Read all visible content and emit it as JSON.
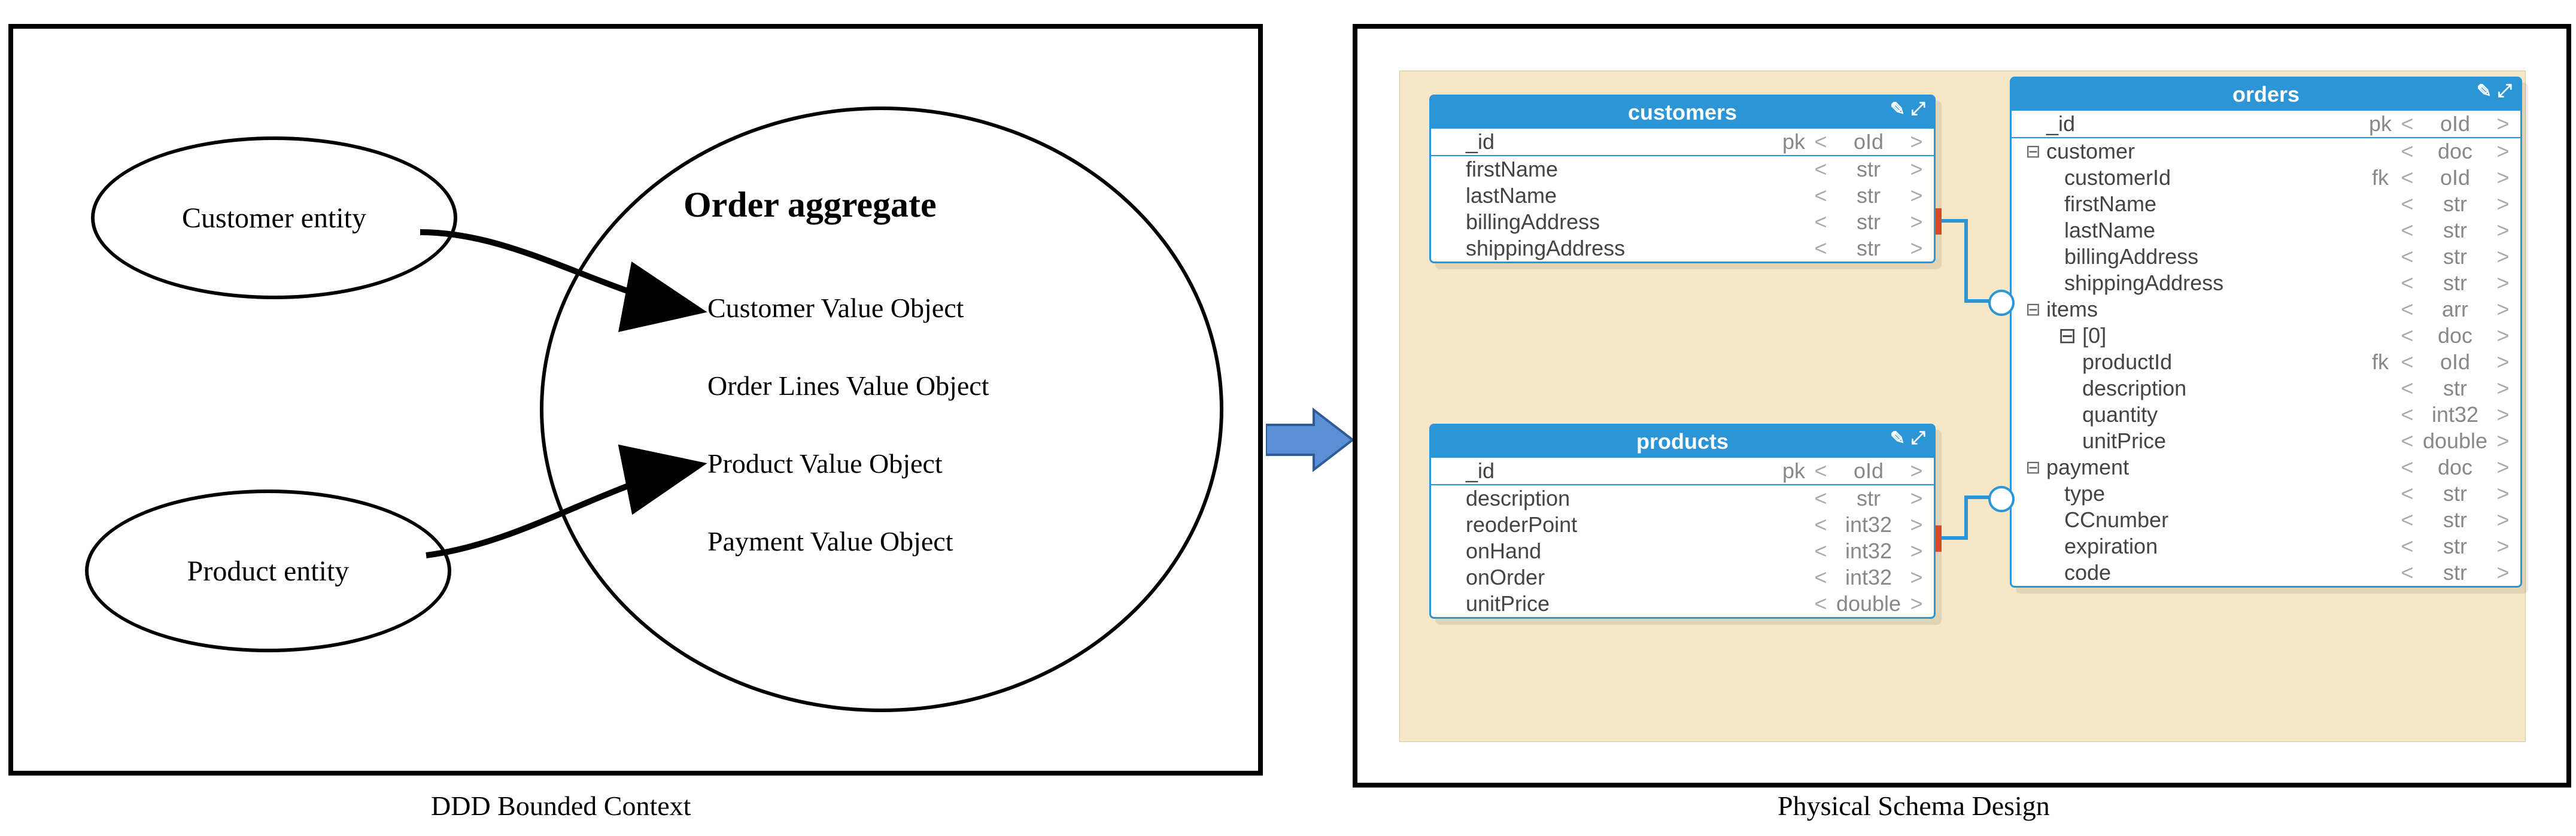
{
  "captions": {
    "left": "DDD Bounded Context",
    "right": "Physical Schema Design"
  },
  "left": {
    "bubble_customer": "Customer entity",
    "bubble_product": "Product entity",
    "aggregate_title": "Order aggregate",
    "vo_customer": "Customer Value Object",
    "vo_orderlines": "Order Lines Value Object",
    "vo_product": "Product Value Object",
    "vo_payment": "Payment Value Object"
  },
  "schema": {
    "customers": {
      "title": "customers",
      "rows": [
        {
          "tree": "",
          "name": "_id",
          "key": "pk",
          "lt": "<",
          "type": "oId",
          "gt": ">"
        },
        {
          "tree": "",
          "name": "firstName",
          "key": "",
          "lt": "<",
          "type": "str",
          "gt": ">"
        },
        {
          "tree": "",
          "name": "lastName",
          "key": "",
          "lt": "<",
          "type": "str",
          "gt": ">"
        },
        {
          "tree": "",
          "name": "billingAddress",
          "key": "",
          "lt": "<",
          "type": "str",
          "gt": ">"
        },
        {
          "tree": "",
          "name": "shippingAddress",
          "key": "",
          "lt": "<",
          "type": "str",
          "gt": ">"
        }
      ]
    },
    "products": {
      "title": "products",
      "rows": [
        {
          "tree": "",
          "name": "_id",
          "key": "pk",
          "lt": "<",
          "type": "oId",
          "gt": ">"
        },
        {
          "tree": "",
          "name": "description",
          "key": "",
          "lt": "<",
          "type": "str",
          "gt": ">"
        },
        {
          "tree": "",
          "name": "reoderPoint",
          "key": "",
          "lt": "<",
          "type": "int32",
          "gt": ">"
        },
        {
          "tree": "",
          "name": "onHand",
          "key": "",
          "lt": "<",
          "type": "int32",
          "gt": ">"
        },
        {
          "tree": "",
          "name": "onOrder",
          "key": "",
          "lt": "<",
          "type": "int32",
          "gt": ">"
        },
        {
          "tree": "",
          "name": "unitPrice",
          "key": "",
          "lt": "<",
          "type": "double",
          "gt": ">"
        }
      ]
    },
    "orders": {
      "title": "orders",
      "rows": [
        {
          "tree": "",
          "name": "_id",
          "key": "pk",
          "lt": "<",
          "type": "oId",
          "gt": ">"
        },
        {
          "tree": "⊟",
          "name": "customer",
          "key": "",
          "lt": "<",
          "type": "doc",
          "gt": ">"
        },
        {
          "tree": "",
          "name": "   customerId",
          "key": "fk",
          "lt": "<",
          "type": "oId",
          "gt": ">"
        },
        {
          "tree": "",
          "name": "   firstName",
          "key": "",
          "lt": "<",
          "type": "str",
          "gt": ">"
        },
        {
          "tree": "",
          "name": "   lastName",
          "key": "",
          "lt": "<",
          "type": "str",
          "gt": ">"
        },
        {
          "tree": "",
          "name": "   billingAddress",
          "key": "",
          "lt": "<",
          "type": "str",
          "gt": ">"
        },
        {
          "tree": "",
          "name": "   shippingAddress",
          "key": "",
          "lt": "<",
          "type": "str",
          "gt": ">"
        },
        {
          "tree": "⊟",
          "name": "items",
          "key": "",
          "lt": "<",
          "type": "arr",
          "gt": ">"
        },
        {
          "tree": "",
          "name": "  ⊟ [0]",
          "key": "",
          "lt": "<",
          "type": "doc",
          "gt": ">"
        },
        {
          "tree": "",
          "name": "      productId",
          "key": "fk",
          "lt": "<",
          "type": "oId",
          "gt": ">"
        },
        {
          "tree": "",
          "name": "      description",
          "key": "",
          "lt": "<",
          "type": "str",
          "gt": ">"
        },
        {
          "tree": "",
          "name": "      quantity",
          "key": "",
          "lt": "<",
          "type": "int32",
          "gt": ">"
        },
        {
          "tree": "",
          "name": "      unitPrice",
          "key": "",
          "lt": "<",
          "type": "double",
          "gt": ">"
        },
        {
          "tree": "⊟",
          "name": "payment",
          "key": "",
          "lt": "<",
          "type": "doc",
          "gt": ">"
        },
        {
          "tree": "",
          "name": "   type",
          "key": "",
          "lt": "<",
          "type": "str",
          "gt": ">"
        },
        {
          "tree": "",
          "name": "   CCnumber",
          "key": "",
          "lt": "<",
          "type": "str",
          "gt": ">"
        },
        {
          "tree": "",
          "name": "   expiration",
          "key": "",
          "lt": "<",
          "type": "str",
          "gt": ">"
        },
        {
          "tree": "",
          "name": "   code",
          "key": "",
          "lt": "<",
          "type": "str",
          "gt": ">"
        }
      ]
    }
  }
}
